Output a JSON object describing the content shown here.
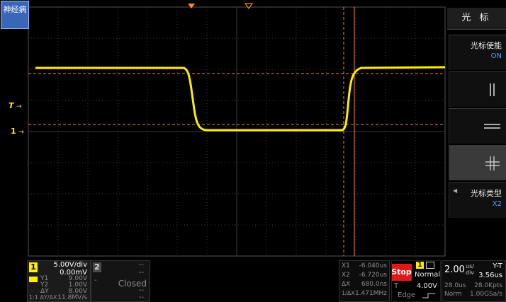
{
  "logo": {
    "text": "神经病"
  },
  "trigger": {
    "marker": "T",
    "arrow": "→"
  },
  "channel_marker": {
    "label": "1",
    "arrow": "→"
  },
  "menu": {
    "title": "光 标",
    "items": [
      {
        "label": "光标使能",
        "value": "ON"
      },
      {
        "label": "",
        "value": ""
      },
      {
        "label": "",
        "value": ""
      },
      {
        "label": "",
        "value": ""
      },
      {
        "label": "光标类型",
        "value": "X2"
      }
    ]
  },
  "channel1": {
    "number": "1",
    "scale": "5.00V/div",
    "offset": "0.00mV",
    "y1_label": "Y1",
    "y1": "9.00V",
    "y2_label": "Y2",
    "y2": "1.00V",
    "dy_label": "ΔY",
    "dy": "8.00V",
    "ratio_label": "1:1 ΔY/ΔX",
    "ratio": "11.8MV/s"
  },
  "channel2": {
    "number": "2",
    "line1": "--",
    "line2": "--",
    "state": "Closed",
    "line3": "--",
    "line4": "--"
  },
  "cursor": {
    "x1_label": "X1",
    "x1": "-6.040us",
    "x2_label": "X2",
    "x2": "-6.720us",
    "dx_label": "ΔX",
    "dx": "680.0ns",
    "inv_label": "1/ΔX",
    "inv": "1.471MHz"
  },
  "run": {
    "state": "Stop"
  },
  "trigger_panel": {
    "channel": "1",
    "mode": "Normal",
    "t_label": "T",
    "level": "4.00V",
    "type": "Edge"
  },
  "timebase": {
    "scale": "2.00",
    "unit_top": "us/",
    "unit_bottom": "div",
    "delay": "28.0us",
    "mode": "Norm",
    "display": "Y-T",
    "time": "3.56us",
    "mem": "28.0Kpts",
    "rate": "1.00GSa/s"
  },
  "colors": {
    "trace": "#ffee00",
    "cursor": "#ff8a1a",
    "grid": "#3a3a3a",
    "accent": "#4aa3ff",
    "stop": "#e01818"
  }
}
